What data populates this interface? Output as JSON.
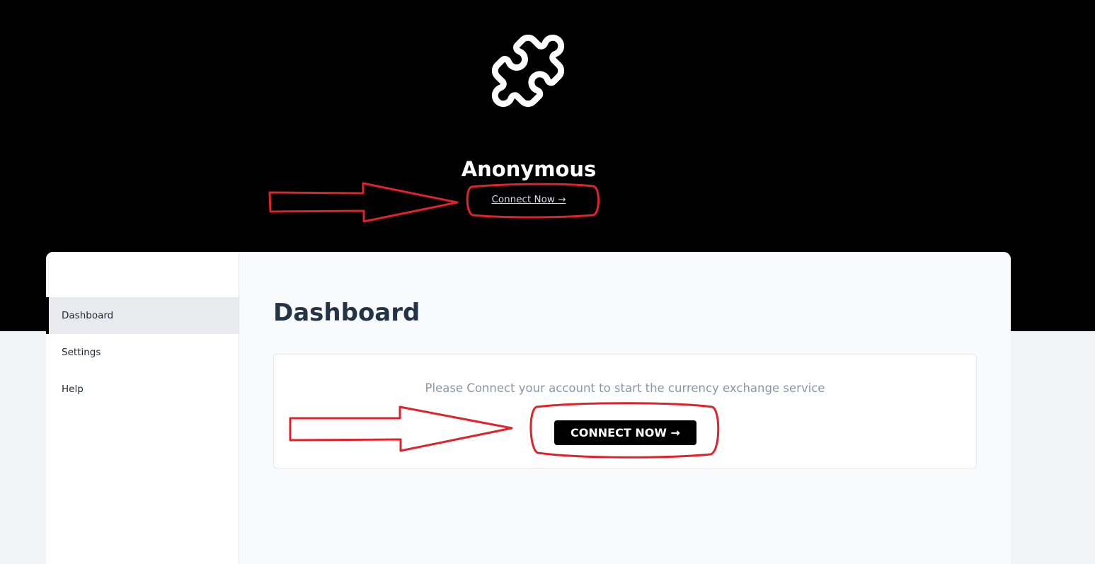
{
  "header": {
    "logo_icon": "puzzle-piece-icon",
    "username": "Anonymous",
    "connect_link": "Connect Now →"
  },
  "sidebar": {
    "items": [
      {
        "label": "Dashboard",
        "active": true
      },
      {
        "label": "Settings",
        "active": false
      },
      {
        "label": "Help",
        "active": false
      }
    ]
  },
  "main": {
    "title": "Dashboard",
    "card": {
      "message": "Please Connect your account to start the currency exchange service",
      "button_label": "CONNECT NOW →"
    }
  },
  "colors": {
    "hero_bg": "#000000",
    "button_bg": "#000000",
    "annotation_red": "#e0222a",
    "title_text": "#243447",
    "muted_text": "#8a96a8"
  }
}
